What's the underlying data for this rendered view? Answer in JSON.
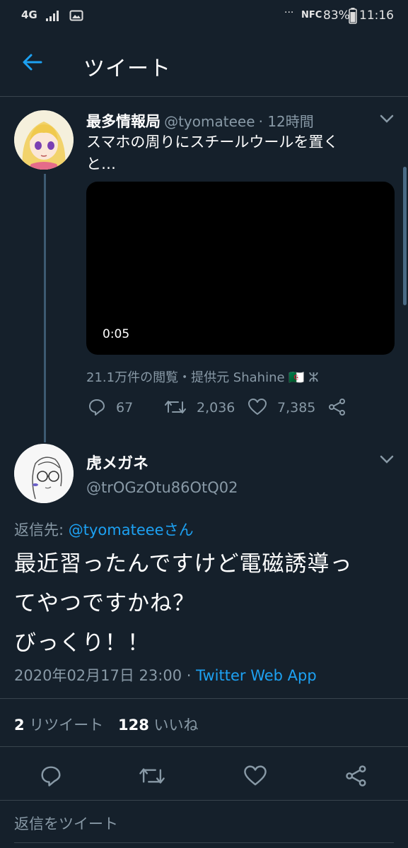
{
  "status": {
    "network": "4G",
    "nfc": "NFC",
    "battery": "83%",
    "time": "11:16"
  },
  "header": {
    "title": "ツイート"
  },
  "parent_tweet": {
    "display_name": "最多情報局",
    "handle": "@tyomateee",
    "time": "· 12時間",
    "text_line1": "スマホの周りにスチールウールを置く",
    "text_line2": "と…",
    "video_duration": "0:05",
    "views": "21.1万件の閲覧・提供元 Shahine 🇩🇿 ⵣ",
    "reply_count": "67",
    "retweet_count": "2,036",
    "like_count": "7,385"
  },
  "main_tweet": {
    "display_name": "虎メガネ",
    "handle": "@trOGzOtu86OtQ02",
    "reply_to_label": "返信先:",
    "reply_to_handle": "@tyomateeeさん",
    "text_line1": "最近習ったんですけど電磁誘導っ",
    "text_line2": "てやつですかね？",
    "text_line3": "びっくり！！",
    "date": "2020年02月17日 23:00",
    "separator": "·",
    "client": "Twitter Web App",
    "retweets_count": "2",
    "retweets_label": "リツイート",
    "likes_count": "128",
    "likes_label": "いいね"
  },
  "reply_box": {
    "placeholder": "返信をツイート"
  },
  "colors": {
    "background": "#15202b",
    "accent": "#1da1f2",
    "muted": "#8899a6",
    "divider": "#38444d"
  }
}
